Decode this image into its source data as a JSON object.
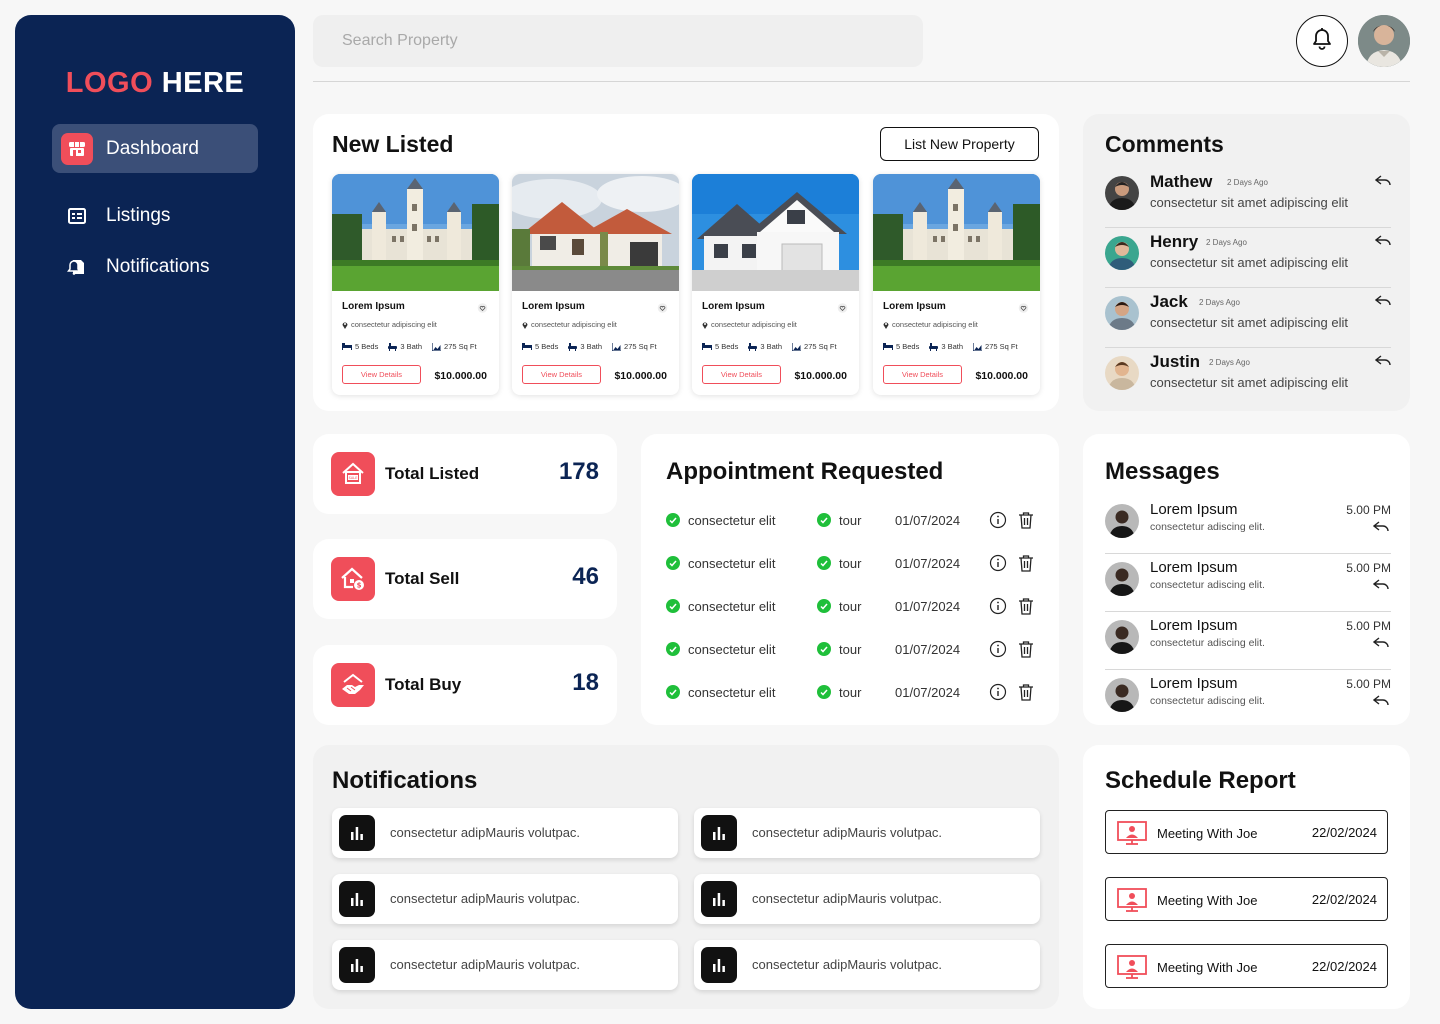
{
  "sidebar": {
    "logo_part1": "LOGO",
    "logo_part2": "HERE",
    "items": [
      {
        "label": "Dashboard",
        "icon": "storefront-icon",
        "active": true
      },
      {
        "label": "Listings",
        "icon": "grid-list-icon",
        "active": false
      },
      {
        "label": "Notifications",
        "icon": "notification-doc-icon",
        "active": false
      }
    ]
  },
  "header": {
    "search_placeholder": "Search Property",
    "bell_icon": "bell-icon",
    "avatar": "user-avatar"
  },
  "new_listed": {
    "title": "New Listed",
    "button": "List New Property",
    "properties": [
      {
        "name": "Lorem Ipsum",
        "address": "consectetur adipiscing elit",
        "beds": "5 Beds",
        "bath": "3 Bath",
        "area": "275 Sq Ft",
        "button": "View Details",
        "price": "$10.000.00",
        "image": "castle"
      },
      {
        "name": "Lorem Ipsum",
        "address": "consectetur adipiscing elit",
        "beds": "5 Beds",
        "bath": "3 Bath",
        "area": "275 Sq Ft",
        "button": "View Details",
        "price": "$10.000.00",
        "image": "villa"
      },
      {
        "name": "Lorem Ipsum",
        "address": "consectetur adipiscing elit",
        "beds": "5 Beds",
        "bath": "3 Bath",
        "area": "275 Sq Ft",
        "button": "View Details",
        "price": "$10.000.00",
        "image": "house"
      },
      {
        "name": "Lorem Ipsum",
        "address": "consectetur adipiscing elit",
        "beds": "5 Beds",
        "bath": "3 Bath",
        "area": "275 Sq Ft",
        "button": "View Details",
        "price": "$10.000.00",
        "image": "castle"
      }
    ]
  },
  "comments": {
    "title": "Comments",
    "items": [
      {
        "name": "Mathew",
        "ago": "2 Days Ago",
        "text": "consectetur sit amet adipiscing elit"
      },
      {
        "name": "Henry",
        "ago": "2 Days Ago",
        "text": "consectetur sit amet adipiscing elit"
      },
      {
        "name": "Jack",
        "ago": "2 Days Ago",
        "text": "consectetur sit amet adipiscing elit"
      },
      {
        "name": "Justin",
        "ago": "2 Days Ago",
        "text": "consectetur sit amet adipiscing elit"
      }
    ]
  },
  "stats": [
    {
      "label": "Total Listed",
      "value": "178",
      "icon": "house-sale-icon"
    },
    {
      "label": "Total Sell",
      "value": "46",
      "icon": "house-dollar-icon"
    },
    {
      "label": "Total Buy",
      "value": "18",
      "icon": "handshake-house-icon"
    }
  ],
  "appointments": {
    "title": "Appointment Requested",
    "rows": [
      {
        "text": "consectetur elit",
        "type": "tour",
        "date": "01/07/2024"
      },
      {
        "text": "consectetur elit",
        "type": "tour",
        "date": "01/07/2024"
      },
      {
        "text": "consectetur elit",
        "type": "tour",
        "date": "01/07/2024"
      },
      {
        "text": "consectetur elit",
        "type": "tour",
        "date": "01/07/2024"
      },
      {
        "text": "consectetur elit",
        "type": "tour",
        "date": "01/07/2024"
      }
    ]
  },
  "messages": {
    "title": "Messages",
    "items": [
      {
        "name": "Lorem Ipsum",
        "text": "consectetur adiscing elit.",
        "time": "5.00 PM"
      },
      {
        "name": "Lorem Ipsum",
        "text": "consectetur adiscing elit.",
        "time": "5.00 PM"
      },
      {
        "name": "Lorem Ipsum",
        "text": "consectetur adiscing elit.",
        "time": "5.00 PM"
      },
      {
        "name": "Lorem Ipsum",
        "text": "consectetur adiscing elit.",
        "time": "5.00 PM"
      }
    ]
  },
  "notifications": {
    "title": "Notifications",
    "items": [
      {
        "text": "consectetur adipMauris volutpac."
      },
      {
        "text": "consectetur adipMauris volutpac."
      },
      {
        "text": "consectetur adipMauris volutpac."
      },
      {
        "text": "consectetur adipMauris volutpac."
      },
      {
        "text": "consectetur adipMauris volutpac."
      },
      {
        "text": "consectetur adipMauris volutpac."
      }
    ]
  },
  "schedule": {
    "title": "Schedule Report",
    "items": [
      {
        "name": "Meeting With Joe",
        "date": "22/02/2024"
      },
      {
        "name": "Meeting With Joe",
        "date": "22/02/2024"
      },
      {
        "name": "Meeting With Joe",
        "date": "22/02/2024"
      }
    ]
  },
  "colors": {
    "sidebar": "#0b2454",
    "accent": "#f04e5a",
    "check": "#1fbf3a",
    "stat_value": "#0b2454"
  }
}
